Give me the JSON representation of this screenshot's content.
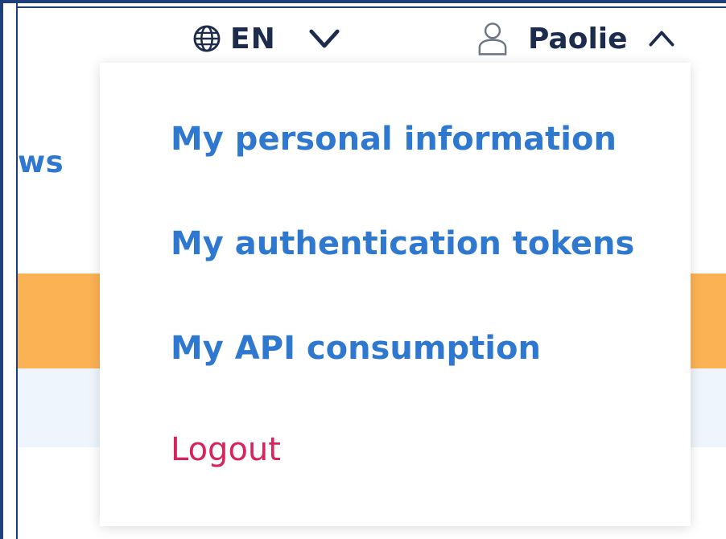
{
  "header": {
    "language": {
      "icon": "globe-icon",
      "code": "EN",
      "toggle_icon": "chevron-down-icon"
    },
    "user": {
      "icon": "person-icon",
      "name": "Paolie",
      "toggle_icon": "chevron-up-icon"
    }
  },
  "background": {
    "partial_link_text": "ws"
  },
  "user_menu": {
    "items": [
      {
        "label": "My personal information"
      },
      {
        "label": "My authentication tokens"
      },
      {
        "label": "My API consumption"
      },
      {
        "label": "Logout"
      }
    ]
  },
  "colors": {
    "menu_link": "#2f78cf",
    "logout": "#d8245d",
    "header_text": "#1d2c4d",
    "orange_band": "#fbb255",
    "light_band": "#eef5fc",
    "frame_border": "#1f3f7a"
  }
}
